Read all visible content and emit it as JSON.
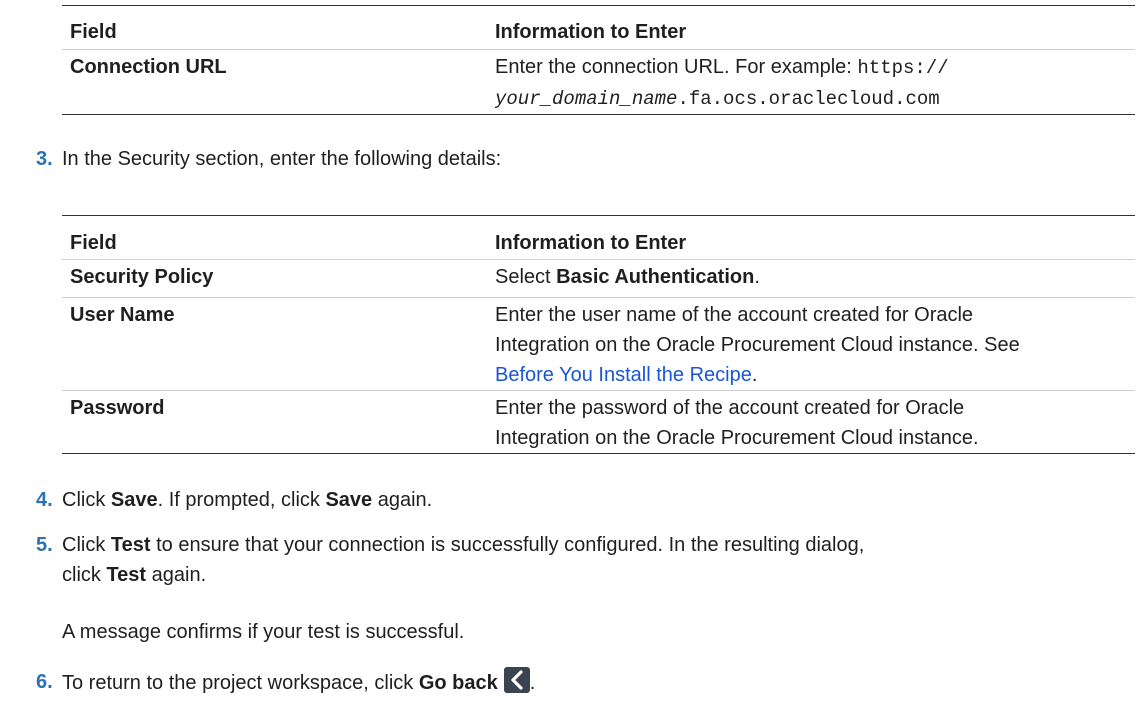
{
  "table1": {
    "headers": [
      "Field",
      "Information to Enter"
    ],
    "rows": [
      {
        "field": "Connection URL",
        "info_prefix": "Enter the connection URL. For example: ",
        "url_part1": "https://",
        "url_italic": "your_domain_name",
        "url_part2": ".fa.ocs.oraclecloud.com"
      }
    ]
  },
  "steps": [
    {
      "num": "3.",
      "text": "In the Security section, enter the following details:"
    },
    {
      "num": "4.",
      "pre": "Click ",
      "b1": "Save",
      "mid": ". If prompted, click ",
      "b2": "Save",
      "post": " again."
    },
    {
      "num": "5.",
      "pre": "Click ",
      "b1": "Test",
      "mid": " to ensure that your connection is successfully configured. In the resulting dialog,",
      "line2_pre": "click ",
      "b2": "Test",
      "post": " again."
    },
    {
      "num": "6.",
      "pre": "To return to the project workspace, click ",
      "b1": "Go back",
      "post": "."
    }
  ],
  "step5_note": "A message confirms if your test is successful.",
  "table2": {
    "headers": [
      "Field",
      "Information to Enter"
    ],
    "rows": [
      {
        "field": "Security Policy",
        "pre": "Select ",
        "bold": "Basic Authentication",
        "post": "."
      },
      {
        "field": "User Name",
        "line1": "Enter the user name of the account created for Oracle",
        "line2": "Integration on the Oracle Procurement Cloud instance. See",
        "link": "Before You Install the Recipe",
        "post": "."
      },
      {
        "field": "Password",
        "line1": "Enter the password of the account created for Oracle",
        "line2": "Integration on the Oracle Procurement Cloud instance."
      }
    ]
  },
  "icons": {
    "go_back": "chevron-left-icon"
  },
  "colors": {
    "step_number": "#2a72b5",
    "link": "#1a55d6",
    "icon_bg": "#3a4450"
  }
}
